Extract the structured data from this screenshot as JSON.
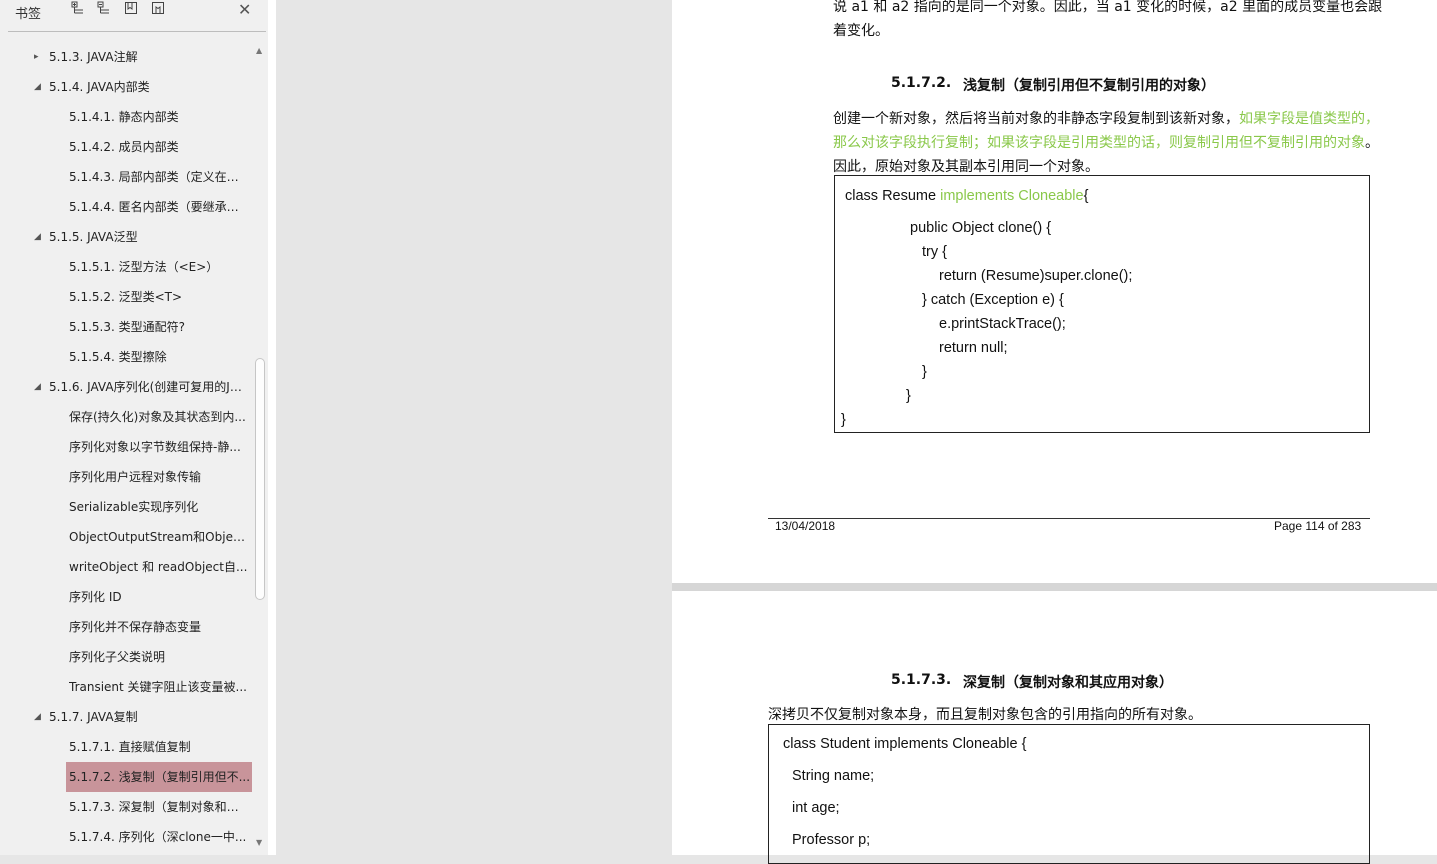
{
  "sidebar": {
    "title": "书签",
    "toolbar_icons": [
      "expand-all-icon",
      "collapse-all-icon",
      "add-bookmark-icon",
      "bookmark-options-icon",
      "close-icon"
    ],
    "items": [
      {
        "label": "5.1.3. JAVA注解",
        "level": 1,
        "toggle": "▸"
      },
      {
        "label": "5.1.4. JAVA内部类",
        "level": 1,
        "toggle": "◢"
      },
      {
        "label": "5.1.4.1. 静态内部类",
        "level": 2,
        "toggle": ""
      },
      {
        "label": "5.1.4.2. 成员内部类",
        "level": 2,
        "toggle": ""
      },
      {
        "label": "5.1.4.3. 局部内部类（定义在方...",
        "level": 2,
        "toggle": ""
      },
      {
        "label": "5.1.4.4. 匿名内部类（要继承一...",
        "level": 2,
        "toggle": ""
      },
      {
        "label": "5.1.5. JAVA泛型",
        "level": 1,
        "toggle": "◢"
      },
      {
        "label": "5.1.5.1. 泛型方法（<E>）",
        "level": 2,
        "toggle": ""
      },
      {
        "label": "5.1.5.2. 泛型类<T>",
        "level": 2,
        "toggle": ""
      },
      {
        "label": "5.1.5.3. 类型通配符?",
        "level": 2,
        "toggle": ""
      },
      {
        "label": "5.1.5.4. 类型擦除",
        "level": 2,
        "toggle": ""
      },
      {
        "label": "5.1.6. JAVA序列化(创建可复用的Ja...",
        "level": 1,
        "toggle": "◢"
      },
      {
        "label": "保存(持久化)对象及其状态到内...",
        "level": 2,
        "toggle": ""
      },
      {
        "label": "序列化对象以字节数组保持-静...",
        "level": 2,
        "toggle": ""
      },
      {
        "label": "序列化用户远程对象传输",
        "level": 2,
        "toggle": ""
      },
      {
        "label": "Serializable实现序列化",
        "level": 2,
        "toggle": ""
      },
      {
        "label": "ObjectOutputStream和Object...",
        "level": 2,
        "toggle": ""
      },
      {
        "label": "writeObject 和 readObject自...",
        "level": 2,
        "toggle": ""
      },
      {
        "label": "序列化 ID",
        "level": 2,
        "toggle": ""
      },
      {
        "label": "序列化并不保存静态变量",
        "level": 2,
        "toggle": ""
      },
      {
        "label": "序列化子父类说明",
        "level": 2,
        "toggle": ""
      },
      {
        "label": "Transient  关键字阻止该变量被...",
        "level": 2,
        "toggle": ""
      },
      {
        "label": "5.1.7. JAVA复制",
        "level": 1,
        "toggle": "◢"
      },
      {
        "label": "5.1.7.1. 直接赋值复制",
        "level": 2,
        "toggle": ""
      },
      {
        "label": "5.1.7.2. 浅复制（复制引用但不...",
        "level": 2,
        "toggle": "",
        "selected": true
      },
      {
        "label": "5.1.7.3. 深复制（复制对象和其...",
        "level": 2,
        "toggle": ""
      },
      {
        "label": "5.1.7.4. 序列化（深clone一中...",
        "level": 2,
        "toggle": ""
      }
    ]
  },
  "page1": {
    "intro_line1": "说 a1 和 a2 指向的是同一个对象。因此，当 a1 变化的时候，a2 里面的成员变量也会跟",
    "intro_line2": "着变化。",
    "heading_num": "5.1.7.2.",
    "heading_text": "浅复制（复制引用但不复制引用的对象）",
    "para_line1_a": "创建一个新对象，然后将当前对象的非静态字段复制到该新对象，",
    "para_line1_b": "如果字段是值类型的，",
    "para_line2_a": "那么对该字段执行复制；如果该字段是引用类型的话，则复制引用但不复制引用的对象",
    "para_line2_b": "。",
    "para_line3": "因此，原始对象及其副本引用同一个对象。",
    "code": {
      "l1a": "class Resume  ",
      "l1b": "implements Cloneable",
      "l1c": "{",
      "l2": "public Object clone() {",
      "l3": "try {",
      "l4": "return (Resume)super.clone();",
      "l5": "} catch (Exception e) {",
      "l6": "e.printStackTrace();",
      "l7": "return null;",
      "l8": "}",
      "l9": "}",
      "l10": "}"
    },
    "footer_date": "13/04/2018",
    "footer_page": "Page 114 of 283"
  },
  "page2": {
    "heading_num": "5.1.7.3.",
    "heading_text": "深复制（复制对象和其应用对象）",
    "para": "深拷贝不仅复制对象本身，而且复制对象包含的引用指向的所有对象。",
    "code": {
      "l1": "class Student implements Cloneable {",
      "l2": "String name;",
      "l3": "int age;",
      "l4": "Professor p;"
    }
  },
  "colors": {
    "highlight_green": "#8ac84a",
    "selected_bg": "#c8949a"
  }
}
